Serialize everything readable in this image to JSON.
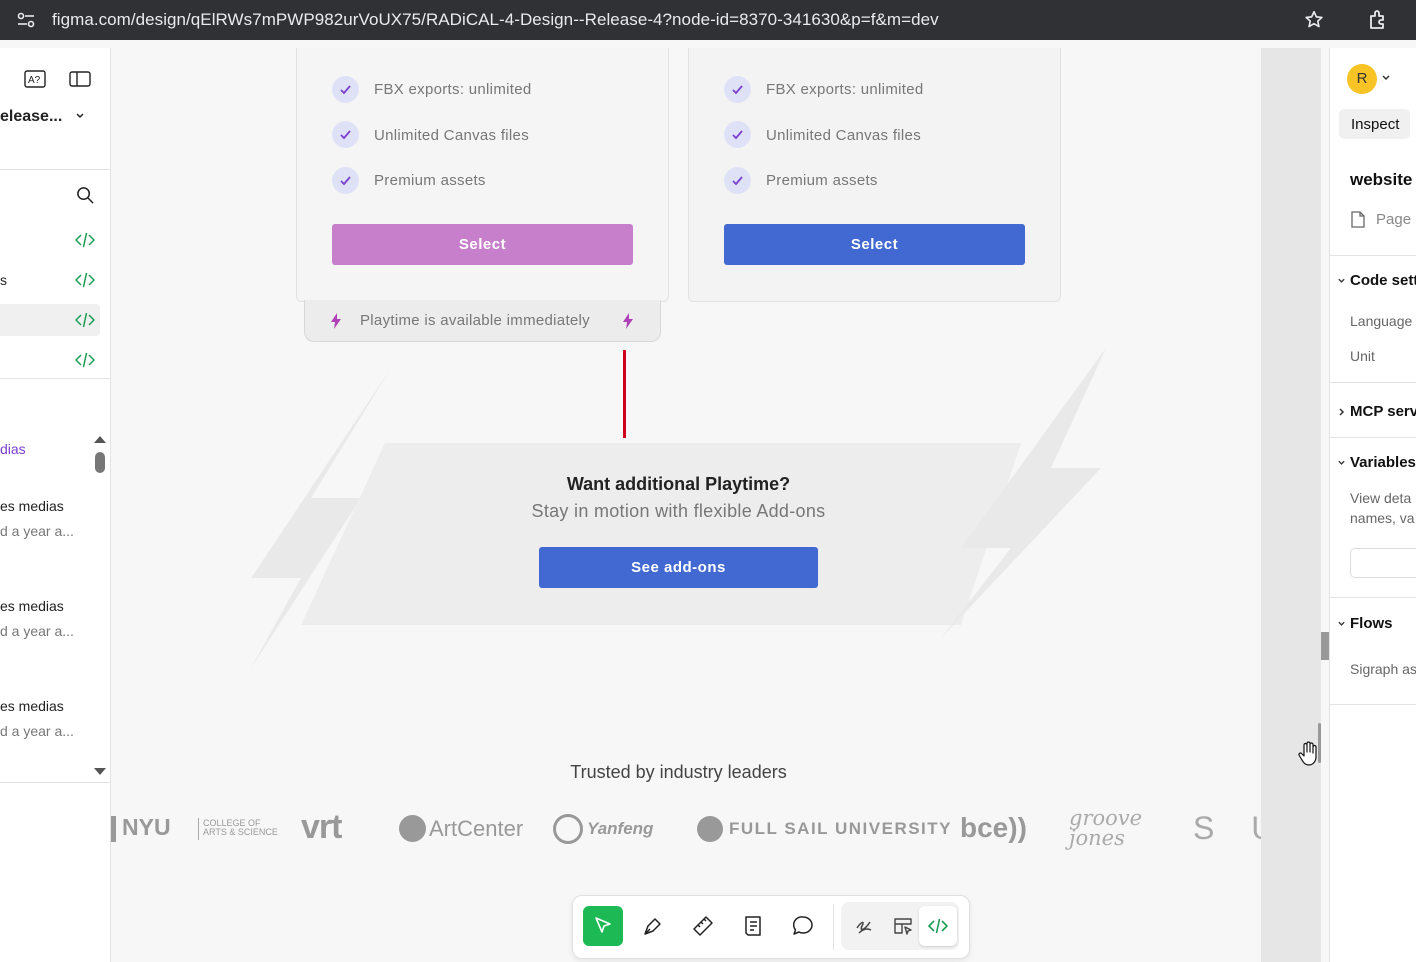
{
  "browser": {
    "url": "figma.com/design/qElRWs7mPWP982urVoUX75/RADiCAL-4-Design--Release-4?node-id=8370-341630&p=f&m=dev"
  },
  "left_panel": {
    "file_name": "elease...",
    "items": [
      {
        "label": "dias"
      },
      {
        "label": "es medias",
        "sub": "d a year a..."
      },
      {
        "label": "es medias",
        "sub": "d a year a..."
      },
      {
        "label": "es medias",
        "sub": "d a year a..."
      }
    ],
    "partial_label": "s"
  },
  "plans": [
    {
      "features": [
        "FBX exports: unlimited",
        "Unlimited Canvas files",
        "Premium assets"
      ],
      "button": "Select",
      "button_color": "#c77fcb",
      "note": "Playtime is available immediately"
    },
    {
      "features": [
        "FBX exports: unlimited",
        "Unlimited Canvas files",
        "Premium assets"
      ],
      "button": "Select",
      "button_color": "#4169d1"
    }
  ],
  "addons": {
    "title": "Want additional Playtime?",
    "subtitle": "Stay in motion with flexible Add-ons",
    "button": "See add-ons"
  },
  "trusted": {
    "heading": "Trusted by industry leaders",
    "logos": [
      "NYU",
      "COLLEGE OF",
      "ARTS & SCIENCE",
      "vrt",
      "ArtCenter",
      "Yanfeng",
      "FULL SAIL UNIVERSITY",
      "bce))",
      "groove jones",
      "S U R"
    ]
  },
  "right_panel": {
    "avatar_initial": "R",
    "tab": "Inspect",
    "title": "website",
    "page_label": "Page",
    "sections": {
      "code_settings": "Code sett",
      "language": "Language",
      "unit": "Unit",
      "mcp": "MCP serve",
      "variables": "Variables",
      "variables_desc_1": "View deta",
      "variables_desc_2": "names, va",
      "flows": "Flows",
      "flow_item": "Sigraph as"
    }
  },
  "colors": {
    "accent_blue": "#4169d1",
    "accent_pink": "#c77fcb",
    "dev_green": "#1a9e52"
  },
  "icons": [
    "site-settings-icon",
    "star-icon",
    "extensions-icon",
    "ai-text-icon",
    "sidebar-toggle-icon",
    "search-icon",
    "code-icon",
    "move-tool-icon",
    "pen-tool-icon",
    "ruler-icon",
    "annotation-icon",
    "comment-icon",
    "draw-icon",
    "handoff-icon",
    "dev-mode-icon"
  ]
}
